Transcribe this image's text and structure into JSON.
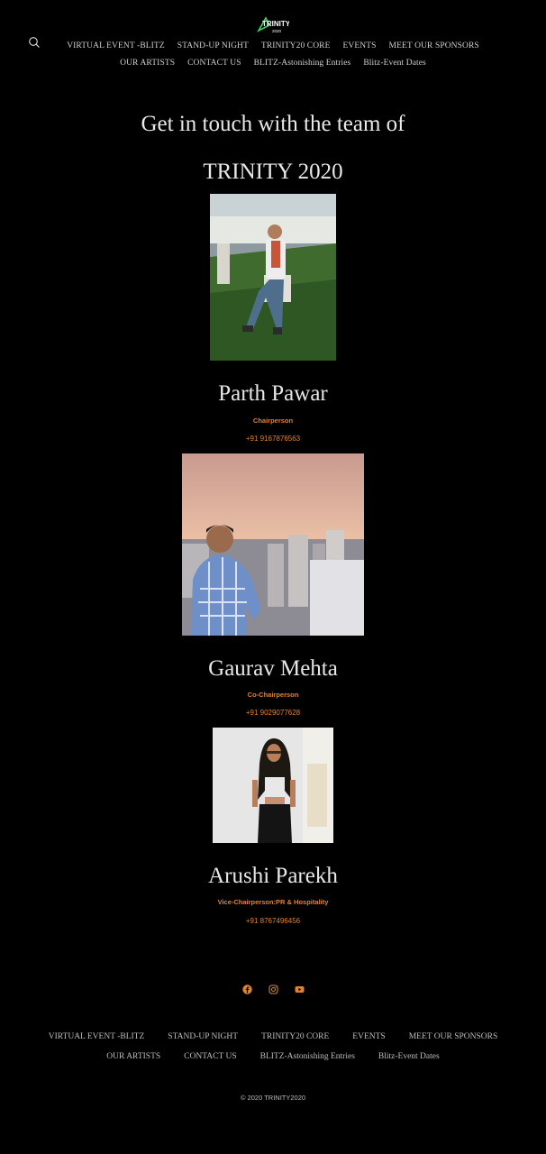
{
  "brand": {
    "logo_text": "TRINITY",
    "logo_subtext": "2020"
  },
  "nav": {
    "row1": [
      "VIRTUAL EVENT -BLITZ",
      "STAND-UP NIGHT",
      "TRINITY20 CORE",
      "EVENTS",
      "MEET OUR SPONSORS"
    ],
    "row2": [
      "OUR ARTISTS",
      "CONTACT US",
      "BLITZ-Astonishing Entries",
      "Blitz-Event Dates"
    ]
  },
  "page": {
    "heading_line1": "Get in touch with the team of",
    "heading_line2": "TRINITY 2020"
  },
  "team": [
    {
      "name": "Parth Pawar",
      "role": "Chairperson",
      "phone": "+91 9167876563"
    },
    {
      "name": "Gaurav Mehta",
      "role": "Co-Chairperson",
      "phone": "+91 9029077628"
    },
    {
      "name": "Arushi Parekh",
      "role": "Vice-Chairperson:PR & Hospitality",
      "phone": "+91 8767496456"
    }
  ],
  "social": {
    "icons": [
      "facebook-icon",
      "instagram-icon",
      "youtube-icon"
    ],
    "color": "#e2832f"
  },
  "footer": {
    "row1": [
      "VIRTUAL EVENT -BLITZ",
      "STAND-UP NIGHT",
      "TRINITY20 CORE",
      "EVENTS",
      "MEET OUR SPONSORS"
    ],
    "row2": [
      "OUR ARTISTS",
      "CONTACT US",
      "BLITZ-Astonishing Entries",
      "Blitz-Event Dates"
    ],
    "copyright": "© 2020  TRINITY2020"
  },
  "colors": {
    "background": "#000000",
    "accent": "#e2832f",
    "text": "#d9d9d9"
  }
}
